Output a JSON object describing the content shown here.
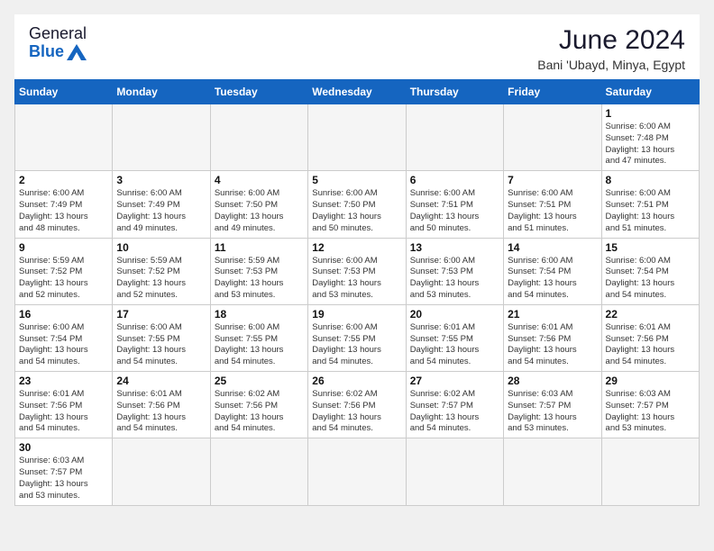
{
  "header": {
    "logo_general": "General",
    "logo_blue": "Blue",
    "month_title": "June 2024",
    "location": "Bani 'Ubayd, Minya, Egypt"
  },
  "weekdays": [
    "Sunday",
    "Monday",
    "Tuesday",
    "Wednesday",
    "Thursday",
    "Friday",
    "Saturday"
  ],
  "weeks": [
    [
      {
        "day": "",
        "info": ""
      },
      {
        "day": "",
        "info": ""
      },
      {
        "day": "",
        "info": ""
      },
      {
        "day": "",
        "info": ""
      },
      {
        "day": "",
        "info": ""
      },
      {
        "day": "",
        "info": ""
      },
      {
        "day": "1",
        "info": "Sunrise: 6:00 AM\nSunset: 7:48 PM\nDaylight: 13 hours\nand 47 minutes."
      }
    ],
    [
      {
        "day": "2",
        "info": "Sunrise: 6:00 AM\nSunset: 7:49 PM\nDaylight: 13 hours\nand 48 minutes."
      },
      {
        "day": "3",
        "info": "Sunrise: 6:00 AM\nSunset: 7:49 PM\nDaylight: 13 hours\nand 49 minutes."
      },
      {
        "day": "4",
        "info": "Sunrise: 6:00 AM\nSunset: 7:50 PM\nDaylight: 13 hours\nand 49 minutes."
      },
      {
        "day": "5",
        "info": "Sunrise: 6:00 AM\nSunset: 7:50 PM\nDaylight: 13 hours\nand 50 minutes."
      },
      {
        "day": "6",
        "info": "Sunrise: 6:00 AM\nSunset: 7:51 PM\nDaylight: 13 hours\nand 50 minutes."
      },
      {
        "day": "7",
        "info": "Sunrise: 6:00 AM\nSunset: 7:51 PM\nDaylight: 13 hours\nand 51 minutes."
      },
      {
        "day": "8",
        "info": "Sunrise: 6:00 AM\nSunset: 7:51 PM\nDaylight: 13 hours\nand 51 minutes."
      }
    ],
    [
      {
        "day": "9",
        "info": "Sunrise: 5:59 AM\nSunset: 7:52 PM\nDaylight: 13 hours\nand 52 minutes."
      },
      {
        "day": "10",
        "info": "Sunrise: 5:59 AM\nSunset: 7:52 PM\nDaylight: 13 hours\nand 52 minutes."
      },
      {
        "day": "11",
        "info": "Sunrise: 5:59 AM\nSunset: 7:53 PM\nDaylight: 13 hours\nand 53 minutes."
      },
      {
        "day": "12",
        "info": "Sunrise: 6:00 AM\nSunset: 7:53 PM\nDaylight: 13 hours\nand 53 minutes."
      },
      {
        "day": "13",
        "info": "Sunrise: 6:00 AM\nSunset: 7:53 PM\nDaylight: 13 hours\nand 53 minutes."
      },
      {
        "day": "14",
        "info": "Sunrise: 6:00 AM\nSunset: 7:54 PM\nDaylight: 13 hours\nand 54 minutes."
      },
      {
        "day": "15",
        "info": "Sunrise: 6:00 AM\nSunset: 7:54 PM\nDaylight: 13 hours\nand 54 minutes."
      }
    ],
    [
      {
        "day": "16",
        "info": "Sunrise: 6:00 AM\nSunset: 7:54 PM\nDaylight: 13 hours\nand 54 minutes."
      },
      {
        "day": "17",
        "info": "Sunrise: 6:00 AM\nSunset: 7:55 PM\nDaylight: 13 hours\nand 54 minutes."
      },
      {
        "day": "18",
        "info": "Sunrise: 6:00 AM\nSunset: 7:55 PM\nDaylight: 13 hours\nand 54 minutes."
      },
      {
        "day": "19",
        "info": "Sunrise: 6:00 AM\nSunset: 7:55 PM\nDaylight: 13 hours\nand 54 minutes."
      },
      {
        "day": "20",
        "info": "Sunrise: 6:01 AM\nSunset: 7:55 PM\nDaylight: 13 hours\nand 54 minutes."
      },
      {
        "day": "21",
        "info": "Sunrise: 6:01 AM\nSunset: 7:56 PM\nDaylight: 13 hours\nand 54 minutes."
      },
      {
        "day": "22",
        "info": "Sunrise: 6:01 AM\nSunset: 7:56 PM\nDaylight: 13 hours\nand 54 minutes."
      }
    ],
    [
      {
        "day": "23",
        "info": "Sunrise: 6:01 AM\nSunset: 7:56 PM\nDaylight: 13 hours\nand 54 minutes."
      },
      {
        "day": "24",
        "info": "Sunrise: 6:01 AM\nSunset: 7:56 PM\nDaylight: 13 hours\nand 54 minutes."
      },
      {
        "day": "25",
        "info": "Sunrise: 6:02 AM\nSunset: 7:56 PM\nDaylight: 13 hours\nand 54 minutes."
      },
      {
        "day": "26",
        "info": "Sunrise: 6:02 AM\nSunset: 7:56 PM\nDaylight: 13 hours\nand 54 minutes."
      },
      {
        "day": "27",
        "info": "Sunrise: 6:02 AM\nSunset: 7:57 PM\nDaylight: 13 hours\nand 54 minutes."
      },
      {
        "day": "28",
        "info": "Sunrise: 6:03 AM\nSunset: 7:57 PM\nDaylight: 13 hours\nand 53 minutes."
      },
      {
        "day": "29",
        "info": "Sunrise: 6:03 AM\nSunset: 7:57 PM\nDaylight: 13 hours\nand 53 minutes."
      }
    ],
    [
      {
        "day": "30",
        "info": "Sunrise: 6:03 AM\nSunset: 7:57 PM\nDaylight: 13 hours\nand 53 minutes."
      },
      {
        "day": "",
        "info": ""
      },
      {
        "day": "",
        "info": ""
      },
      {
        "day": "",
        "info": ""
      },
      {
        "day": "",
        "info": ""
      },
      {
        "day": "",
        "info": ""
      },
      {
        "day": "",
        "info": ""
      }
    ]
  ]
}
